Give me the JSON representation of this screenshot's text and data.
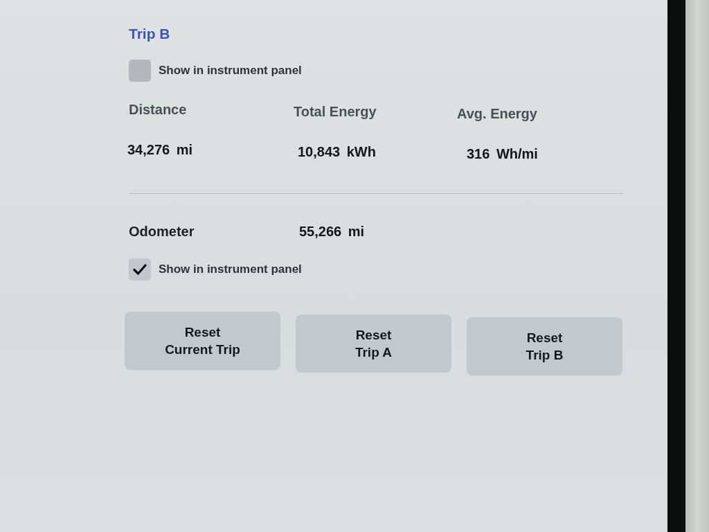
{
  "trip_b": {
    "title": "Trip B",
    "show_in_panel": {
      "label": "Show in instrument panel",
      "checked": false
    },
    "stats": [
      {
        "label": "Distance",
        "value": "34,276 mi"
      },
      {
        "label": "Total Energy",
        "value": "10,843 kWh"
      },
      {
        "label": "Avg. Energy",
        "value": "316 Wh/mi"
      }
    ]
  },
  "odometer": {
    "label": "Odometer",
    "value": "55,266 mi",
    "show_in_panel": {
      "label": "Show in instrument panel",
      "checked": true
    }
  },
  "buttons": [
    {
      "label": "Reset\nCurrent Trip"
    },
    {
      "label": "Reset\nTrip A"
    },
    {
      "label": "Reset\nTrip B"
    }
  ]
}
